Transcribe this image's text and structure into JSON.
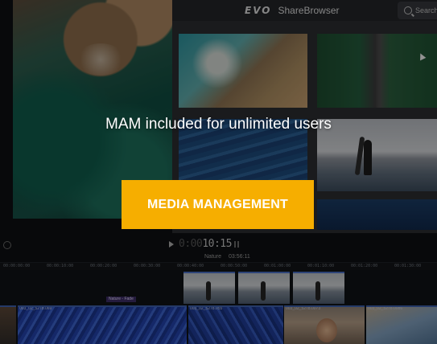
{
  "sharebrowser": {
    "logo_mark": "EVO",
    "app_name": "ShareBrowser",
    "search_placeholder": "Search"
  },
  "editor": {
    "timecode_dim": "0:00",
    "timecode": "10:15",
    "sequence_name": "Nature",
    "sequence_duration": "03:56:11",
    "ruler_ticks": [
      "00:00:00:00",
      "00:00:10:00",
      "00:00:20:00",
      "00:00:30:00",
      "00:00:40:00",
      "00:00:50:00",
      "00:01:00:00",
      "00:01:10:00",
      "00:01:20:00",
      "00:01:30:00"
    ],
    "fade_label": "Nature - Fade",
    "clip_labels": [
      "003_02_5278.069",
      "003_02_5278.055",
      "003_02_5278.0073",
      "003_02_5278.0086"
    ]
  },
  "hero": {
    "title": "MAM included for unlimited users",
    "cta_label": "MEDIA MANAGEMENT"
  },
  "colors": {
    "cta_background": "#f6ae00",
    "cta_text": "#ffffff",
    "title_text": "#ffffff"
  }
}
